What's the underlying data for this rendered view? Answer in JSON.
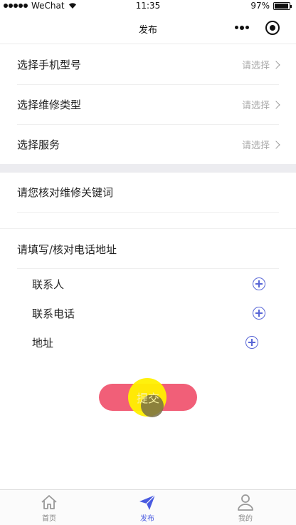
{
  "status_bar": {
    "carrier": "WeChat",
    "time": "11:35",
    "battery": "97%",
    "battery_level": 0.97
  },
  "nav": {
    "title": "发布"
  },
  "form": {
    "rows": [
      {
        "label": "选择手机型号",
        "value": "请选择"
      },
      {
        "label": "选择维修类型",
        "value": "请选择"
      },
      {
        "label": "选择服务",
        "value": "请选择"
      }
    ],
    "keyword_label": "请您核对维修关键词",
    "address_title": "请填写/核对电话地址",
    "contacts": [
      {
        "label": "联系人"
      },
      {
        "label": "联系电话"
      },
      {
        "label": "地址"
      }
    ],
    "submit_label": "提交"
  },
  "tabbar": {
    "items": [
      {
        "label": "首页",
        "icon": "home-icon"
      },
      {
        "label": "发布",
        "icon": "send-icon"
      },
      {
        "label": "我的",
        "icon": "user-icon"
      }
    ]
  },
  "colors": {
    "accent": "#4a5be0",
    "submit": "#f15f78",
    "plus": "#5866d6"
  }
}
